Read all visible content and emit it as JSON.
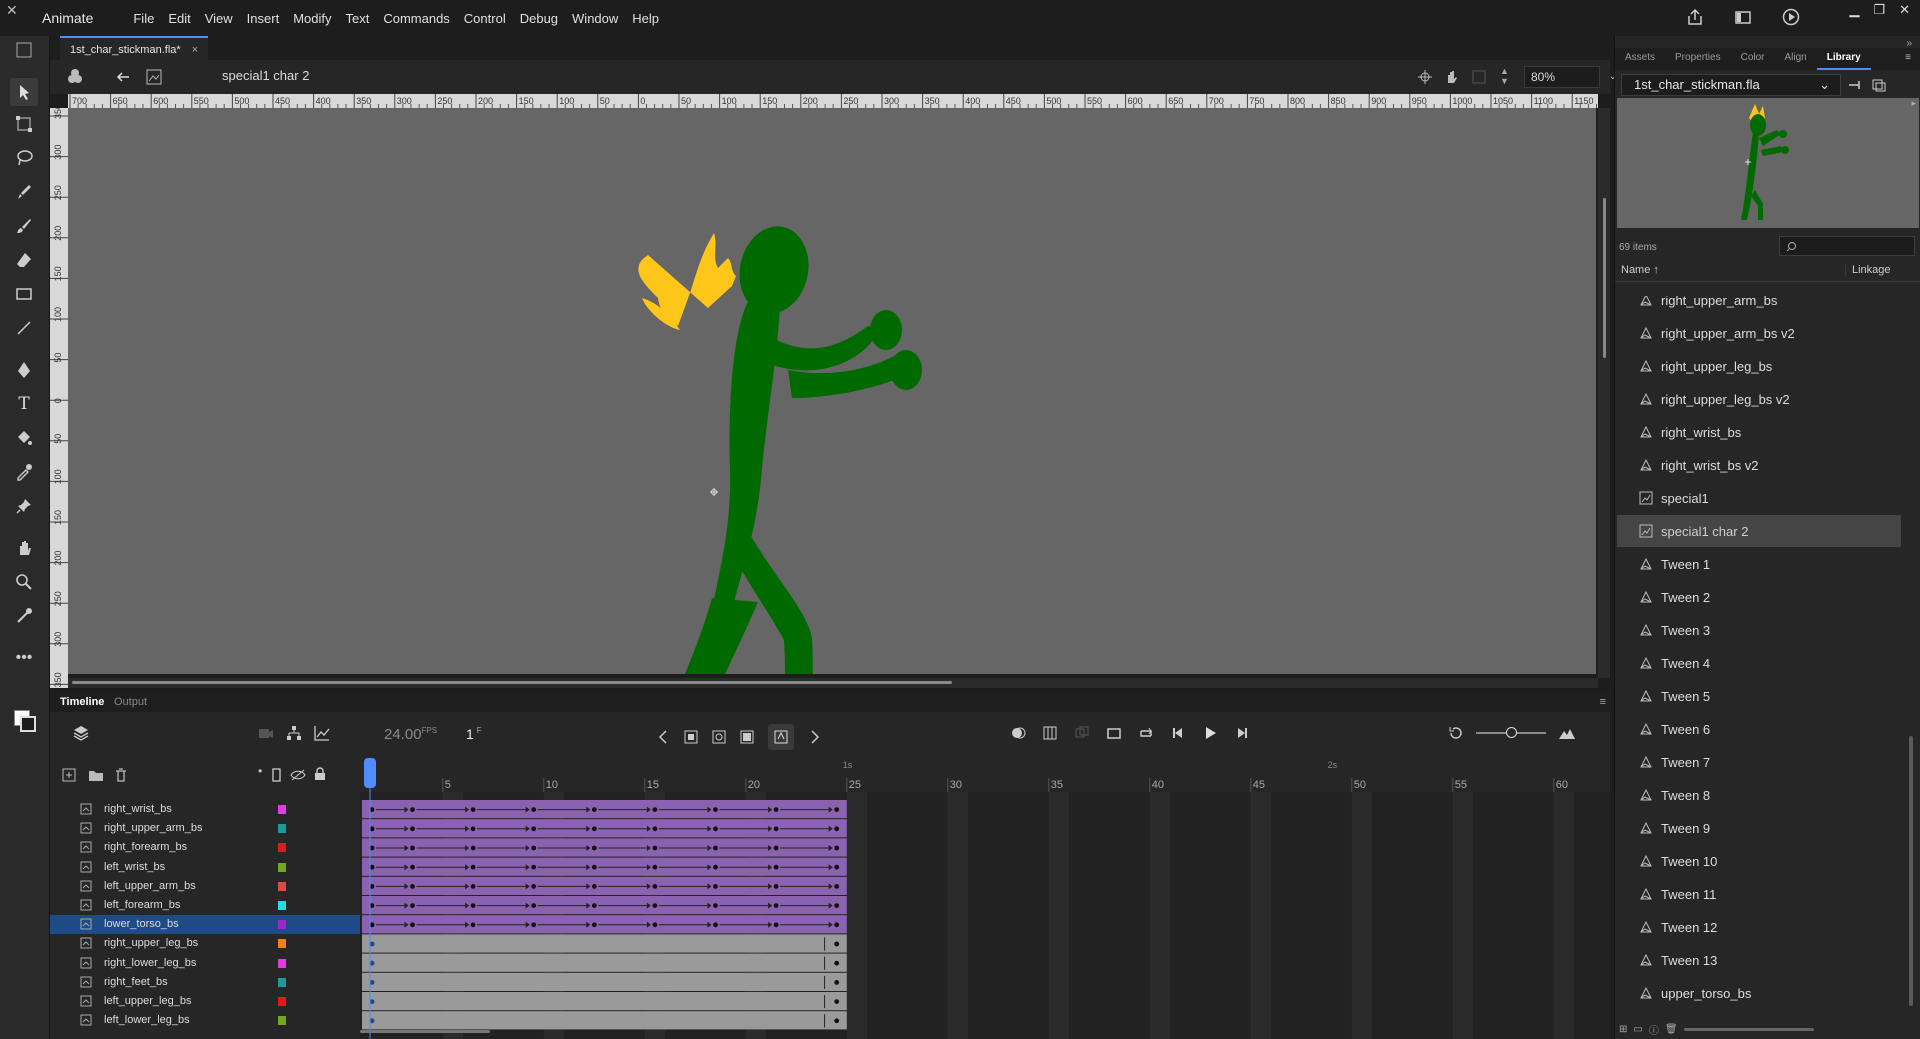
{
  "app": {
    "name": "Animate"
  },
  "menu": [
    "File",
    "Edit",
    "View",
    "Insert",
    "Modify",
    "Text",
    "Commands",
    "Control",
    "Debug",
    "Window",
    "Help"
  ],
  "document": {
    "tab_label": "1st_char_stickman.fla*",
    "close_glyph": "×"
  },
  "editbar": {
    "scene_name": "special1 char 2",
    "zoom": "80%"
  },
  "rulers": {
    "h_ticks": [
      "700",
      "650",
      "600",
      "550",
      "500",
      "450",
      "400",
      "350",
      "300",
      "250",
      "200",
      "150",
      "100",
      "50",
      "0",
      "50",
      "100",
      "150",
      "200",
      "250",
      "300",
      "350",
      "400",
      "450",
      "500",
      "550",
      "600",
      "650",
      "700",
      "750",
      "800",
      "850",
      "900",
      "950",
      "1000",
      "1050",
      "1100",
      "1150"
    ],
    "v_ticks": [
      "350",
      "300",
      "250",
      "200",
      "150",
      "100",
      "50",
      "0",
      "50",
      "100",
      "150",
      "200",
      "250",
      "300",
      "350"
    ]
  },
  "right_panel": {
    "tabs": [
      "Assets",
      "Properties",
      "Color",
      "Align",
      "Library"
    ],
    "active_tab": "Library",
    "library_file": "1st_char_stickman.fla",
    "item_count": "69 items",
    "col_name": "Name",
    "col_linkage": "Linkage",
    "items": [
      {
        "label": "right_upper_arm_bs",
        "type": "graphic"
      },
      {
        "label": "right_upper_arm_bs v2",
        "type": "graphic"
      },
      {
        "label": "right_upper_leg_bs",
        "type": "graphic"
      },
      {
        "label": "right_upper_leg_bs v2",
        "type": "graphic"
      },
      {
        "label": "right_wrist_bs",
        "type": "graphic"
      },
      {
        "label": "right_wrist_bs v2",
        "type": "graphic"
      },
      {
        "label": "special1",
        "type": "movie"
      },
      {
        "label": "special1 char 2",
        "type": "movie"
      },
      {
        "label": "Tween 1",
        "type": "graphic"
      },
      {
        "label": "Tween 2",
        "type": "graphic"
      },
      {
        "label": "Tween 3",
        "type": "graphic"
      },
      {
        "label": "Tween 4",
        "type": "graphic"
      },
      {
        "label": "Tween 5",
        "type": "graphic"
      },
      {
        "label": "Tween 6",
        "type": "graphic"
      },
      {
        "label": "Tween 7",
        "type": "graphic"
      },
      {
        "label": "Tween 8",
        "type": "graphic"
      },
      {
        "label": "Tween 9",
        "type": "graphic"
      },
      {
        "label": "Tween 10",
        "type": "graphic"
      },
      {
        "label": "Tween 11",
        "type": "graphic"
      },
      {
        "label": "Tween 12",
        "type": "graphic"
      },
      {
        "label": "Tween 13",
        "type": "graphic"
      },
      {
        "label": "upper_torso_bs",
        "type": "graphic"
      }
    ],
    "selected_item": "special1 char 2"
  },
  "timeline": {
    "tabs": [
      "Timeline",
      "Output"
    ],
    "active_tab": "Timeline",
    "fps": "24.00",
    "fps_unit": "FPS",
    "current_frame": "1",
    "frame_unit": "F",
    "frame_ticks": [
      "5",
      "10",
      "15",
      "20",
      "25",
      "30",
      "35",
      "40",
      "45",
      "50",
      "55",
      "60"
    ],
    "time_marks": [
      "1s",
      "2s"
    ],
    "layers": [
      {
        "name": "right_wrist_bs",
        "color": "#e23be2",
        "tween": true
      },
      {
        "name": "right_upper_arm_bs",
        "color": "#1a9a9a",
        "tween": true
      },
      {
        "name": "right_forearm_bs",
        "color": "#e01a1a",
        "tween": true
      },
      {
        "name": "left_wrist_bs",
        "color": "#6fa820",
        "tween": true
      },
      {
        "name": "left_upper_arm_bs",
        "color": "#e04848",
        "tween": true
      },
      {
        "name": "left_forearm_bs",
        "color": "#22e0e0",
        "tween": true
      },
      {
        "name": "lower_torso_bs",
        "color": "#9a28c8",
        "tween": true
      },
      {
        "name": "right_upper_leg_bs",
        "color": "#f0801a",
        "tween": false
      },
      {
        "name": "right_lower_leg_bs",
        "color": "#e23be2",
        "tween": false
      },
      {
        "name": "right_feet_bs",
        "color": "#1a9a9a",
        "tween": false
      },
      {
        "name": "left_upper_leg_bs",
        "color": "#e01a1a",
        "tween": false
      },
      {
        "name": "left_lower_leg_bs",
        "color": "#6fa820",
        "tween": false
      }
    ],
    "selected_layer": "lower_torso_bs"
  },
  "colors": {
    "stage": "#666666",
    "figure": "#006a00",
    "crown": "#ffc61a",
    "tween": "#8a62b0",
    "accent": "#4e8cff"
  }
}
